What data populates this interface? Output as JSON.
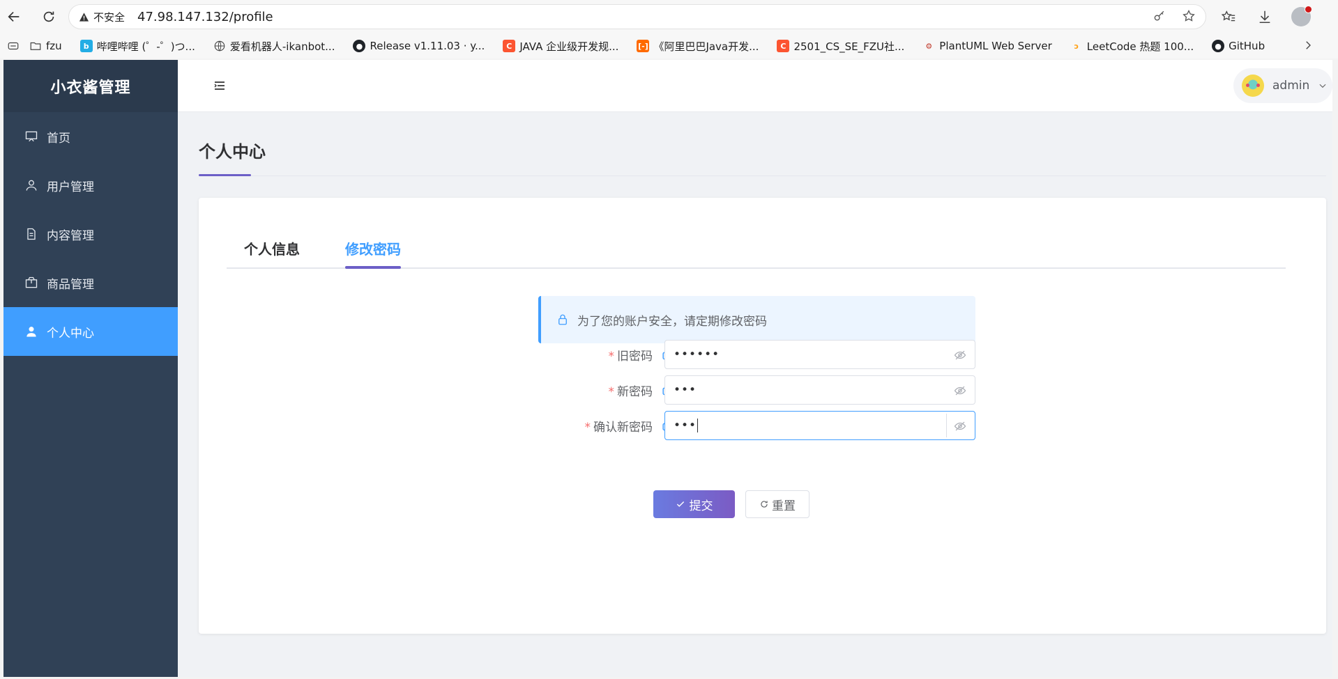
{
  "browser": {
    "security_label": "不安全",
    "url": "47.98.147.132/profile",
    "bookmarks": [
      {
        "label": "fzu",
        "icon": "folder-icon"
      },
      {
        "label": "哔哩哔哩 (゜-゜)つ...",
        "icon": "bilibili-icon"
      },
      {
        "label": "爱看机器人-ikanbot...",
        "icon": "globe-icon"
      },
      {
        "label": "Release v1.11.03 · y...",
        "icon": "github-icon"
      },
      {
        "label": "JAVA 企业级开发规...",
        "icon": "csdn-icon"
      },
      {
        "label": "《阿里巴巴Java开发...",
        "icon": "aliyun-icon"
      },
      {
        "label": "2501_CS_SE_FZU社...",
        "icon": "csdn-icon"
      },
      {
        "label": "PlantUML Web Server",
        "icon": "plantuml-icon"
      },
      {
        "label": "LeetCode 热题 100...",
        "icon": "leetcode-icon"
      },
      {
        "label": "GitHub",
        "icon": "github-icon"
      }
    ]
  },
  "sidebar": {
    "brand": "小衣酱管理",
    "items": [
      {
        "label": "首页",
        "icon": "dashboard-icon",
        "active": false
      },
      {
        "label": "用户管理",
        "icon": "user-icon",
        "active": false
      },
      {
        "label": "内容管理",
        "icon": "document-icon",
        "active": false
      },
      {
        "label": "商品管理",
        "icon": "package-icon",
        "active": false
      },
      {
        "label": "个人中心",
        "icon": "user-filled-icon",
        "active": true
      }
    ]
  },
  "header": {
    "username": "admin"
  },
  "page": {
    "title": "个人中心",
    "tabs": [
      {
        "label": "个人信息",
        "active": false
      },
      {
        "label": "修改密码",
        "active": true
      }
    ],
    "notice": "为了您的账户安全，请定期修改密码",
    "form": {
      "old_password": {
        "label": "旧密码",
        "value": "••••••"
      },
      "new_password": {
        "label": "新密码",
        "value": "•••"
      },
      "confirm_password": {
        "label": "确认新密码",
        "value": "•••"
      }
    },
    "submit_label": "提交",
    "reset_label": "重置"
  },
  "colors": {
    "sidebar_bg": "#304156",
    "active_menu": "#409eff",
    "accent": "#6c5fc7",
    "required": "#f56c6c"
  }
}
